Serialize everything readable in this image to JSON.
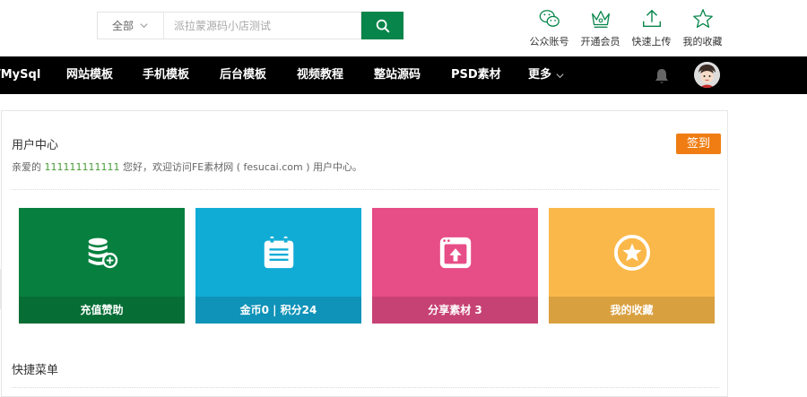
{
  "search": {
    "scope_label": "全部",
    "placeholder": "派拉蒙源码小店测试"
  },
  "top_actions": [
    {
      "label": "公众账号",
      "icon": "wechat-icon"
    },
    {
      "label": "开通会员",
      "icon": "crown-icon"
    },
    {
      "label": "快速上传",
      "icon": "upload-icon"
    },
    {
      "label": "我的收藏",
      "icon": "star-icon"
    }
  ],
  "nav": {
    "items": [
      "/MySql",
      "网站模板",
      "手机模板",
      "后台模板",
      "视频教程",
      "整站源码",
      "PSD素材"
    ],
    "more_label": "更多"
  },
  "user_center": {
    "title": "用户中心",
    "welcome_prefix": "亲爱的 ",
    "username": "111111111111",
    "welcome_suffix": " 您好，欢迎访问FE素材网 ( fesucai.com ) 用户中心。",
    "checkin_label": "签到"
  },
  "cards": [
    {
      "label": "充值赞助",
      "icon": "coins-add-icon",
      "top_color": "#07803f",
      "bottom_color": "#066d35"
    },
    {
      "label": "金币0 | 积分24",
      "icon": "calendar-icon",
      "top_color": "#11acd6",
      "bottom_color": "#0f93b8"
    },
    {
      "label": "分享素材 3",
      "icon": "share-upload-icon",
      "top_color": "#e74d87",
      "bottom_color": "#c74274"
    },
    {
      "label": "我的收藏",
      "icon": "star-circle-icon",
      "top_color": "#fbb84a",
      "bottom_color": "#d9a03f"
    }
  ],
  "quick_menu": {
    "title": "快捷菜单"
  },
  "colors": {
    "brand_green": "#07854a",
    "nav_bg": "#000000",
    "checkin_orange": "#f07d13"
  }
}
